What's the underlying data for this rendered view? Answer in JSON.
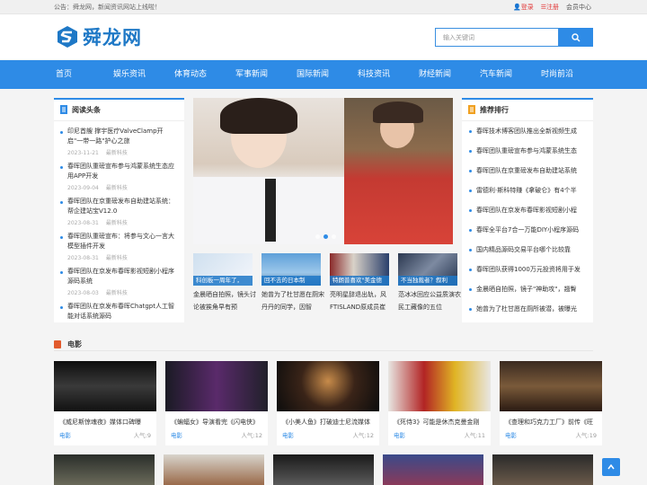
{
  "topbar": {
    "notice": "公告：舜龙网，新闻资讯网站上线啦！",
    "login": "登录",
    "register": "注册",
    "member": "会员中心"
  },
  "logo": {
    "text": "舜龙网",
    "icon": "sunlong-s-logo"
  },
  "search": {
    "placeholder": "输入关键词",
    "icon": "search-icon"
  },
  "nav": [
    "首页",
    "娱乐资讯",
    "体育动态",
    "军事新闻",
    "国际新闻",
    "科技资讯",
    "财经新闻",
    "汽车新闻",
    "时尚前沿"
  ],
  "left_panel": {
    "title": "阅读头条",
    "items": [
      {
        "title": "印尼首艘 撑宇医疗ValveClamp开启\"一带一路\"护心之旅",
        "date": "2023-11-21",
        "cat": "最新科技"
      },
      {
        "title": "春晖团队重磅宣布参与鸿蒙系统生态应用APP开发",
        "date": "2023-09-04",
        "cat": "最新科技"
      },
      {
        "title": "春晖团队在京重磅发布自助建站系统：帮企建站宝V12.0",
        "date": "2023-08-31",
        "cat": "最新科技"
      },
      {
        "title": "春晖团队重磅宣布：将参与文心一言大模型插件开发",
        "date": "2023-08-31",
        "cat": "最新科技"
      },
      {
        "title": "春晖团队在京发布春晖影视短剧小程序源码系统",
        "date": "2023-08-03",
        "cat": "最新科技"
      },
      {
        "title": "春晖团队在京发布春晖Chatgpt人工智能对话系统源码",
        "date": "",
        "cat": ""
      }
    ]
  },
  "thumbs": [
    {
      "caption": "科创板一周年了，",
      "title": "金晨晒自拍照，镜头讨论被挨角早有预"
    },
    {
      "caption": "回不去的日本制",
      "title": "她曾为了杜甘愿在厕宋丹丹的同学，因智"
    },
    {
      "caption": "特朗普喜欢\"美金德",
      "title": "亮明星辞退出轨，风FTISLAND原成员崔"
    },
    {
      "caption": "不当独裁者？叙利",
      "title": "范冰冰回应公益质演农民工藏像的五位"
    }
  ],
  "right_panel": {
    "title": "推荐排行",
    "items": [
      "春晖技术博客团队推出全新视频生成",
      "春晖团队重磅宣布参与鸿蒙系统生态",
      "春晖团队在京重磅发布自助建站系统",
      "雷德利·斯科特赚《拿破仑》有4个半",
      "春晖团队在京发布春晖影视短剧小程",
      "春晖全平台7合一万能DIY小程序源码",
      "国内精品源码交易平台哪个比较靠",
      "春晖团队获得1000万元投资将用于发",
      "金晨晒自拍照，镜子\"神助攻\"，翘臀",
      "她曾为了杜甘愿在厕所被潜，被曝光"
    ]
  },
  "section": {
    "title": "电影"
  },
  "films": [
    {
      "title": "《威尼斯惊魂夜》媒体口碑曝",
      "cat": "电影",
      "pop": "人气:9"
    },
    {
      "title": "《蝙蝠女》导演看完《闪电侠》",
      "cat": "电影",
      "pop": "人气:12"
    },
    {
      "title": "《小美人鱼》打破迪士尼流媒体",
      "cat": "电影",
      "pop": "人气:12"
    },
    {
      "title": "《死侍3》可能是休杰克曼金刚",
      "cat": "电影",
      "pop": "人气:11"
    },
    {
      "title": "《查理和巧克力工厂》前传《旺",
      "cat": "电影",
      "pop": "人气:19"
    }
  ],
  "colors": {
    "accent": "#2e8be6",
    "section_icon": "#e25a2c",
    "login_red": "#e23b3b"
  }
}
